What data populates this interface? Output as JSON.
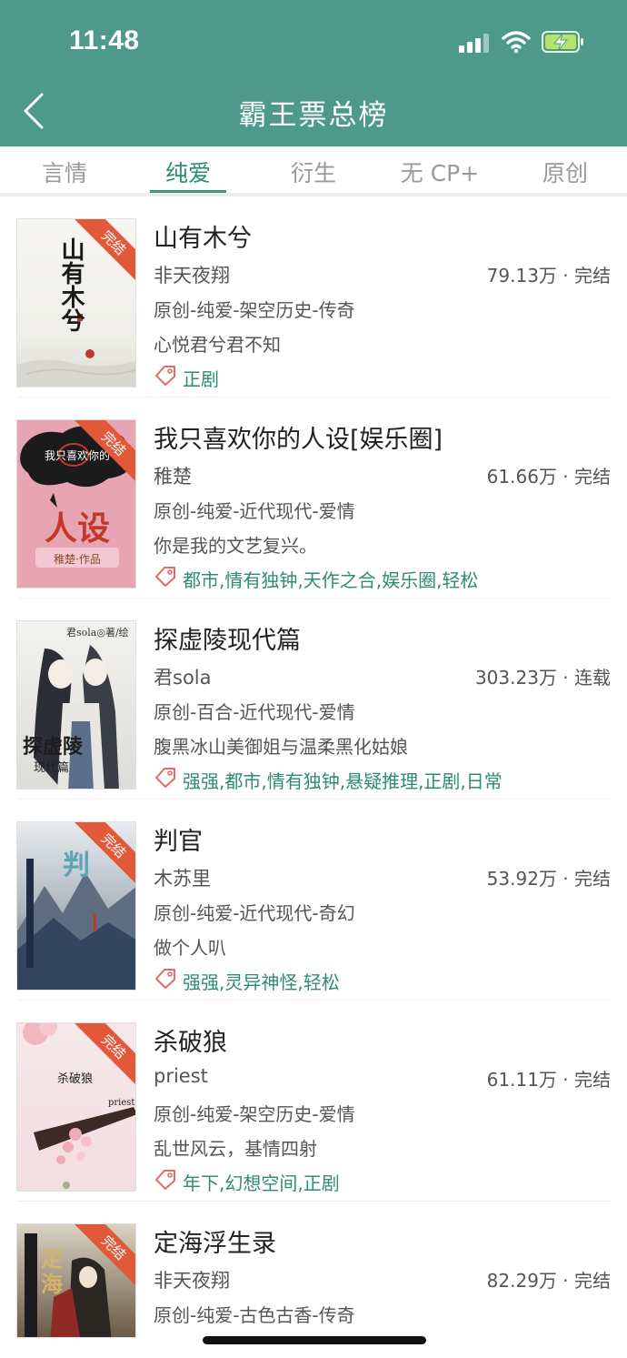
{
  "status_bar": {
    "time": "11:48"
  },
  "header": {
    "title": "霸王票总榜"
  },
  "tabs": [
    {
      "label": "言情"
    },
    {
      "label": "纯爱"
    },
    {
      "label": "衍生"
    },
    {
      "label": "无 CP+"
    },
    {
      "label": "原创"
    }
  ],
  "active_tab": "纯爱",
  "icons": {
    "back": "chevron-left-icon",
    "signal": "signal-icon",
    "wifi": "wifi-icon",
    "battery": "battery-charging-icon",
    "tag": "tag-icon"
  },
  "colors": {
    "header": "#4e9a8a",
    "accent": "#2e8b74",
    "badge": "#e2593a"
  },
  "books": [
    {
      "title": "山有木兮",
      "author": "非天夜翔",
      "stats": "79.13万 · 完结",
      "category": "原创-纯爱-架空历史-传奇",
      "intro": "心悦君兮君不知",
      "tags": "正剧",
      "badge": "完结",
      "cover_text": "山有木兮"
    },
    {
      "title": "我只喜欢你的人设[娱乐圈]",
      "author": "稚楚",
      "stats": "61.66万 · 完结",
      "category": "原创-纯爱-近代现代-爱情",
      "intro": "你是我的文艺复兴。",
      "tags": "都市,情有独钟,天作之合,娱乐圈,轻松",
      "badge": "完结",
      "cover_text": "人设",
      "cover_subtext": "我只喜欢你的",
      "cover_author": "稚楚·作品"
    },
    {
      "title": "探虚陵现代篇",
      "author": "君sola",
      "stats": "303.23万 · 连载",
      "category": "原创-百合-近代现代-爱情",
      "intro": "腹黑冰山美御姐与温柔黑化姑娘",
      "tags": "强强,都市,情有独钟,悬疑推理,正剧,日常",
      "badge": "",
      "cover_text": "探虚陵",
      "cover_subtext": "现代篇",
      "cover_author": "君sola◎著/绘"
    },
    {
      "title": "判官",
      "author": "木苏里",
      "stats": "53.92万 · 完结",
      "category": "原创-纯爱-近代现代-奇幻",
      "intro": "做个人叭",
      "tags": "强强,灵异神怪,轻松",
      "badge": "完结",
      "cover_text": "判"
    },
    {
      "title": "杀破狼",
      "author": "priest",
      "stats": "61.11万 · 完结",
      "category": "原创-纯爱-架空历史-爱情",
      "intro": "乱世风云，基情四射",
      "tags": "年下,幻想空间,正剧",
      "badge": "完结",
      "cover_text": "杀破狼",
      "cover_author": "priest"
    },
    {
      "title": "定海浮生录",
      "author": "非天夜翔",
      "stats": "82.29万 · 完结",
      "category": "原创-纯爱-古色古香-传奇",
      "intro": "",
      "tags": "",
      "badge": "完结",
      "cover_text": "定海"
    }
  ]
}
